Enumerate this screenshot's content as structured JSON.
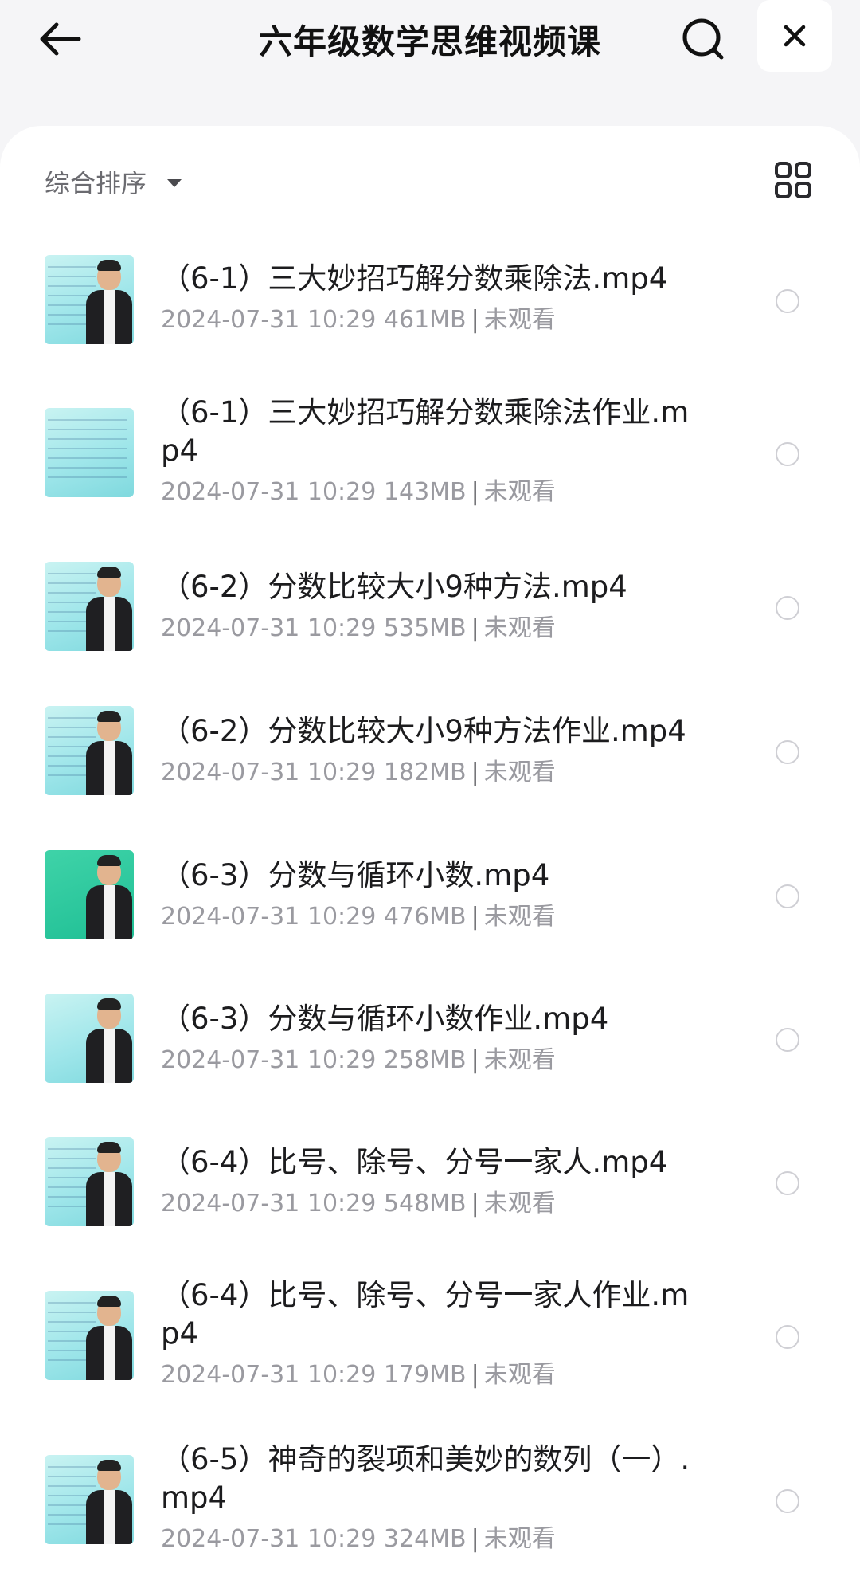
{
  "header": {
    "title": "六年级数学思维视频课",
    "back_icon": "arrow-left-icon",
    "search_icon": "search-icon",
    "close_icon": "close-icon"
  },
  "toolbar": {
    "sort_label": "综合排序",
    "grid_icon": "grid-view-icon"
  },
  "files": [
    {
      "title": "（6-1）三大妙招巧解分数乘除法.mp4",
      "date": "2024-07-31 10:29",
      "size": "461MB",
      "status": "未观看"
    },
    {
      "title": "（6-1）三大妙招巧解分数乘除法作业.mp4",
      "date": "2024-07-31 10:29",
      "size": "143MB",
      "status": "未观看"
    },
    {
      "title": "（6-2）分数比较大小9种方法.mp4",
      "date": "2024-07-31 10:29",
      "size": "535MB",
      "status": "未观看"
    },
    {
      "title": "（6-2）分数比较大小9种方法作业.mp4",
      "date": "2024-07-31 10:29",
      "size": "182MB",
      "status": "未观看"
    },
    {
      "title": "（6-3）分数与循环小数.mp4",
      "date": "2024-07-31 10:29",
      "size": "476MB",
      "status": "未观看"
    },
    {
      "title": "（6-3）分数与循环小数作业.mp4",
      "date": "2024-07-31 10:29",
      "size": "258MB",
      "status": "未观看"
    },
    {
      "title": "（6-4）比号、除号、分号一家人.mp4",
      "date": "2024-07-31 10:29",
      "size": "548MB",
      "status": "未观看"
    },
    {
      "title": "（6-4）比号、除号、分号一家人作业.mp4",
      "date": "2024-07-31 10:29",
      "size": "179MB",
      "status": "未观看"
    },
    {
      "title": "（6-5）神奇的裂项和美妙的数列（一）.mp4",
      "date": "2024-07-31 10:29",
      "size": "324MB",
      "status": "未观看"
    }
  ]
}
